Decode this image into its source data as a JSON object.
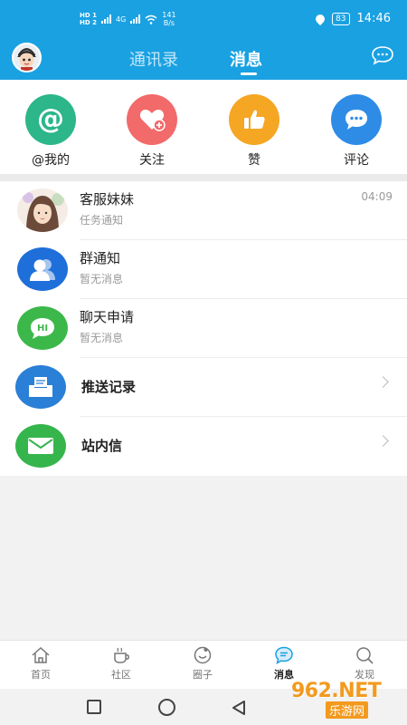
{
  "status_bar": {
    "hd1": "HD 1",
    "hd2": "HD 2",
    "network": "4G",
    "speed_value": "141",
    "speed_unit": "B/s",
    "battery": "83",
    "time": "14:46"
  },
  "header": {
    "tabs": [
      {
        "label": "通讯录",
        "active": false
      },
      {
        "label": "消息",
        "active": true
      }
    ]
  },
  "quick_actions": [
    {
      "label": "@我的",
      "icon": "at-icon",
      "color": "#2cb68a"
    },
    {
      "label": "关注",
      "icon": "heart-plus-icon",
      "color": "#f26a6a"
    },
    {
      "label": "赞",
      "icon": "thumbs-up-icon",
      "color": "#f5a623"
    },
    {
      "label": "评论",
      "icon": "comment-icon",
      "color": "#2e8ce6"
    }
  ],
  "messages": [
    {
      "title": "客服妹妹",
      "subtitle": "任务通知",
      "time": "04:09"
    },
    {
      "title": "群通知",
      "subtitle": "暂无消息"
    },
    {
      "title": "聊天申请",
      "subtitle": "暂无消息"
    }
  ],
  "links": [
    {
      "label": "推送记录",
      "icon": "inbox-icon"
    },
    {
      "label": "站内信",
      "icon": "mail-icon"
    }
  ],
  "bottom_nav": [
    {
      "label": "首页",
      "icon": "home-icon",
      "active": false
    },
    {
      "label": "社区",
      "icon": "coffee-icon",
      "active": false
    },
    {
      "label": "圈子",
      "icon": "smile-circle-icon",
      "active": false
    },
    {
      "label": "消息",
      "icon": "message-icon",
      "active": true
    },
    {
      "label": "发现",
      "icon": "search-icon",
      "active": false
    }
  ],
  "watermark": {
    "text": "962.NET",
    "sub": "乐游网"
  },
  "colors": {
    "brand": "#1aa1e2",
    "group_blue": "#1e6fd9",
    "chat_green": "#3cb84a",
    "push_blue": "#2a7fd6",
    "mail_green": "#36b54c"
  }
}
